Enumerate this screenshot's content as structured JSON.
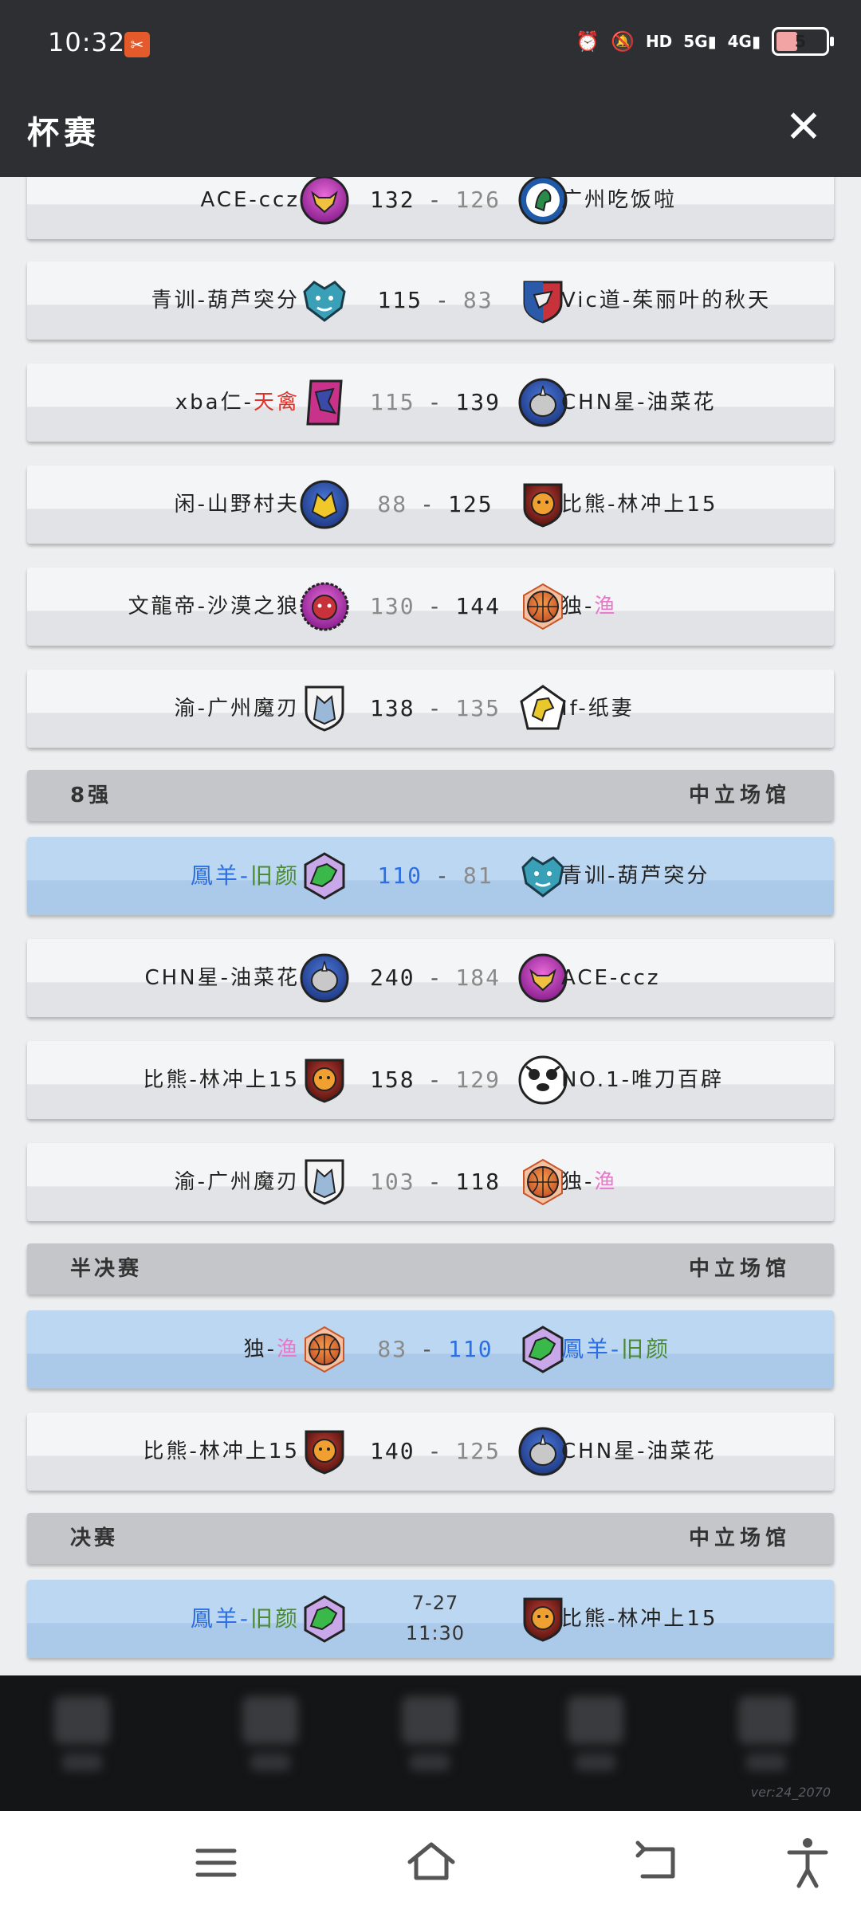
{
  "status_bar": {
    "time": "10:32",
    "notification_icon": "app-notification-icon",
    "icons": [
      "alarm-icon",
      "mute-icon",
      "hd-icon",
      "5g-signal-icon",
      "4g-signal-icon"
    ],
    "hd_label": "HD",
    "sig5g_label": "5G",
    "sig4g_label": "4G",
    "battery_level": "5"
  },
  "header": {
    "title": "杯赛",
    "close_icon": "close-icon"
  },
  "rows": [
    {
      "home": "ACE-ccz",
      "home_score": "132",
      "away_score": "126",
      "away": "广州吃饭啦",
      "home_logo": "bull",
      "away_logo": "horse",
      "winner": "home"
    },
    {
      "home": "青训-葫芦突分",
      "home_score": "115",
      "away_score": "83",
      "away": "Vic道-茱丽叶的秋天",
      "home_logo": "boar",
      "away_logo": "eagle",
      "winner": "home"
    },
    {
      "home_parts": [
        "xba仁-",
        "天禽"
      ],
      "home_score": "115",
      "away_score": "139",
      "away": "CHN星-油菜花",
      "home_logo": "bird",
      "away_logo": "rhino",
      "winner": "away"
    },
    {
      "home": "闲-山野村夫",
      "home_score": "88",
      "away_score": "125",
      "away": "比熊-林冲上15",
      "home_logo": "dragon",
      "away_logo": "lion",
      "winner": "away"
    },
    {
      "home": "文龍帝-沙漠之狼",
      "home_score": "130",
      "away_score": "144",
      "away_parts": [
        "独-",
        "渔"
      ],
      "home_logo": "demon",
      "away_logo": "ball",
      "winner": "away"
    },
    {
      "home": "渝-广州魔刃",
      "home_score": "138",
      "away_score": "135",
      "away": "If-纸妻",
      "home_logo": "wolf",
      "away_logo": "griffin",
      "winner": "home"
    }
  ],
  "sections": [
    {
      "name": "8强",
      "venue": "中立场馆"
    },
    {
      "name": "半决赛",
      "venue": "中立场馆"
    },
    {
      "name": "决赛",
      "venue": "中立场馆"
    }
  ],
  "quarter": [
    {
      "home_parts": [
        "鳳羊-",
        "旧颜"
      ],
      "home_score": "110",
      "away_score": "81",
      "away": "青训-葫芦突分",
      "winner": "home",
      "highlight": true
    },
    {
      "home": "CHN星-油菜花",
      "home_score": "240",
      "away_score": "184",
      "away": "ACE-ccz",
      "winner": "home"
    },
    {
      "home": "比熊-林冲上15",
      "home_score": "158",
      "away_score": "129",
      "away": "NO.1-唯刀百辟",
      "winner": "home"
    },
    {
      "home": "渝-广州魔刃",
      "home_score": "103",
      "away_score": "118",
      "away_parts": [
        "独-",
        "渔"
      ],
      "winner": "away"
    }
  ],
  "semi": [
    {
      "home_parts": [
        "独-",
        "渔"
      ],
      "home_score": "83",
      "away_score": "110",
      "away_parts": [
        "鳳羊-",
        "旧颜"
      ],
      "winner": "away",
      "highlight": true
    },
    {
      "home": "比熊-林冲上15",
      "home_score": "140",
      "away_score": "125",
      "away": "CHN星-油菜花",
      "winner": "home"
    }
  ],
  "final": {
    "home_parts": [
      "鳳羊-",
      "旧颜"
    ],
    "date": "7-27",
    "time": "11:30",
    "away": "比熊-林冲上15"
  },
  "score_dash": "-",
  "footer": {
    "version": "ver:24_2070"
  },
  "colors": {
    "header_bg": "#2d2f33",
    "highlight_row": "#bcd7f1",
    "win_blue": "#2d6fe0",
    "red_text": "#e0322a",
    "pink_text": "#e878c9",
    "green_text": "#4a8a30"
  },
  "system_nav": {
    "buttons": [
      "menu-icon",
      "home-icon",
      "back-icon",
      "accessibility-icon"
    ]
  }
}
